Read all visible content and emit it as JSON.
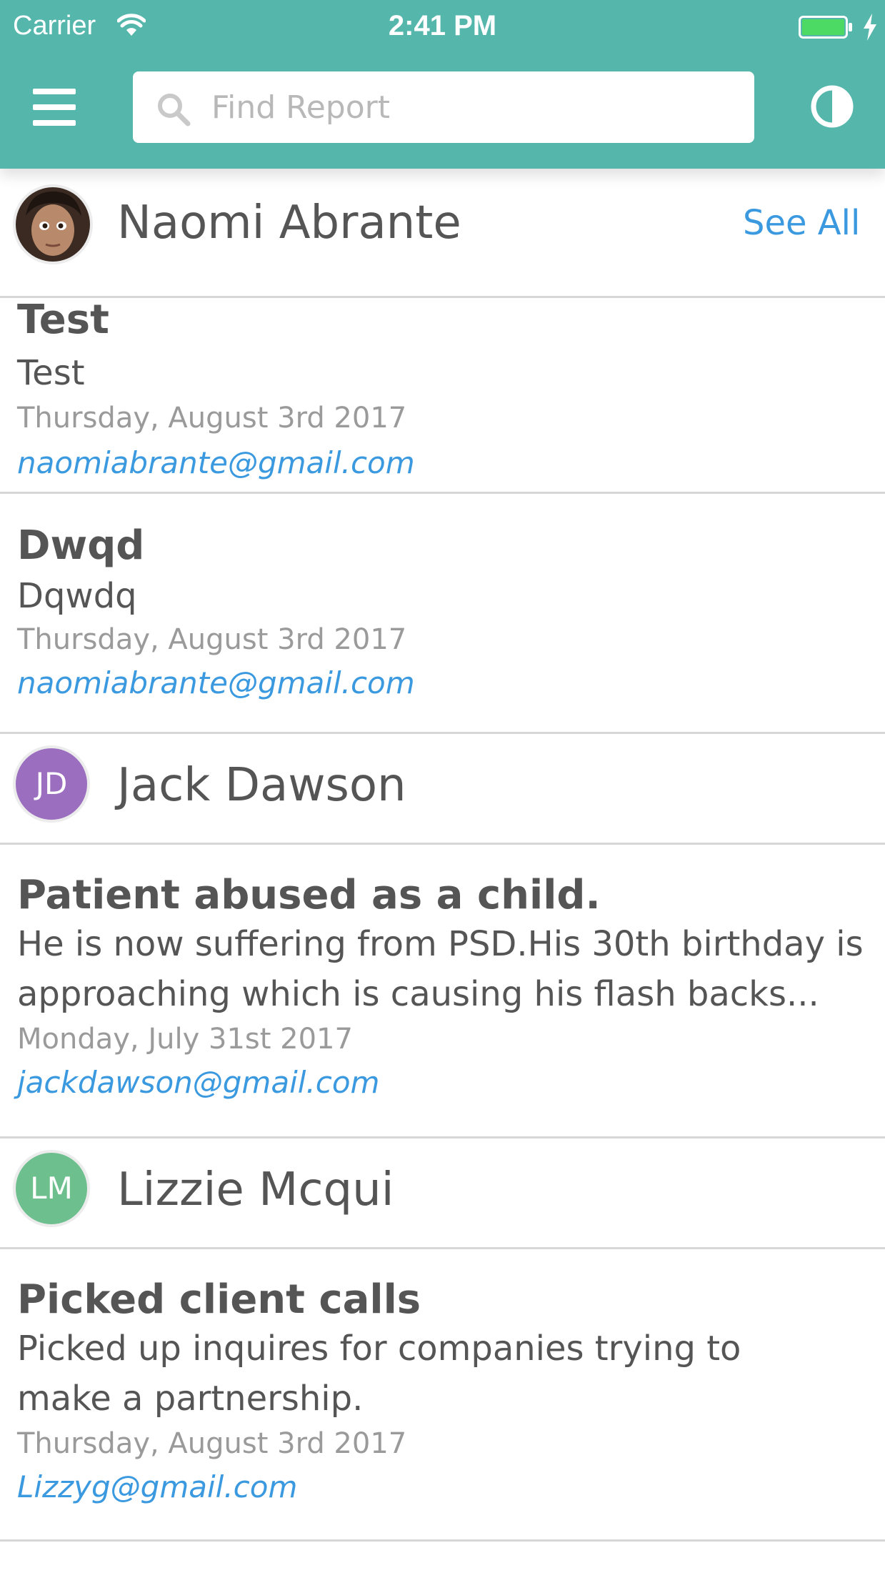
{
  "status_bar": {
    "carrier": "Carrier",
    "time": "2:41 PM"
  },
  "header": {
    "search_placeholder": "Find Report",
    "icons": {
      "menu": "menu-icon",
      "search": "search-icon",
      "contrast": "contrast-icon"
    },
    "background_color": "#55b7ac"
  },
  "sections": [
    {
      "user_name": "Naomi Abrante",
      "avatar": "photo",
      "see_all_label": "See All",
      "reports": [
        {
          "title": "Test",
          "body": "Test",
          "date": "Thursday, August 3rd 2017",
          "email": "naomiabrante@gmail.com"
        },
        {
          "title": "Dwqd",
          "body": "Dqwdq",
          "date": "Thursday, August 3rd 2017",
          "email": "naomiabrante@gmail.com"
        }
      ]
    },
    {
      "user_name": "Jack Dawson",
      "avatar_initials": "JD",
      "avatar_color": "#9b6ec0",
      "reports": [
        {
          "title": "Patient abused as a child.",
          "body": "He is now suffering from PSD.His 30th birthday is approaching which is causing his flash backs...",
          "date": "Monday, July 31st 2017",
          "email": "jackdawson@gmail.com"
        }
      ]
    },
    {
      "user_name": "Lizzie Mcqui",
      "avatar_initials": "LM",
      "avatar_color": "#6dbf8e",
      "reports": [
        {
          "title": "Picked client calls",
          "body": "Picked up inquires for companies trying to make a partnership.",
          "date": "Thursday, August 3rd 2017",
          "email": "Lizzyg@gmail.com"
        }
      ]
    }
  ],
  "colors": {
    "link": "#3a99df",
    "text": "#555555",
    "muted": "#9a9a9a"
  }
}
